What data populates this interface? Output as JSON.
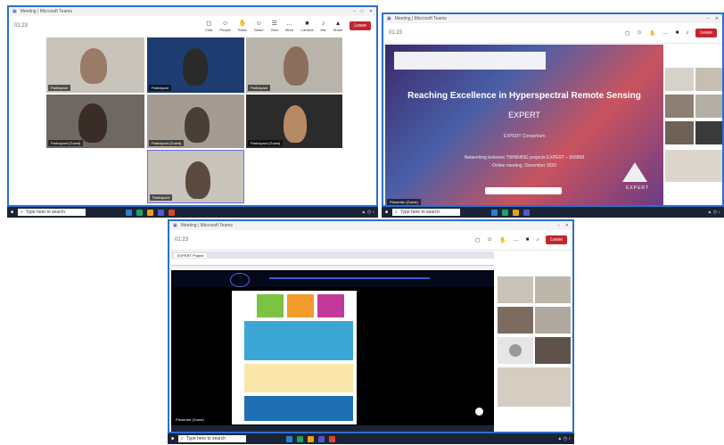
{
  "top_left": {
    "title": "Meeting | Microsoft Teams",
    "timer": "01:23",
    "tools": [
      {
        "icon": "people-icon",
        "label": "Chat"
      },
      {
        "icon": "people-icon",
        "label": "People"
      },
      {
        "icon": "hand-icon",
        "label": "Raise"
      },
      {
        "icon": "react-icon",
        "label": "React"
      },
      {
        "icon": "view-icon",
        "label": "View"
      },
      {
        "icon": "more-icon",
        "label": "More"
      },
      {
        "icon": "camera-icon",
        "label": "Camera"
      },
      {
        "icon": "mic-icon",
        "label": "Mic"
      },
      {
        "icon": "share-icon",
        "label": "Share"
      }
    ],
    "leave": "Leave",
    "participants": [
      "Participant",
      "Participant",
      "Participant",
      "Participant (Guest)",
      "Participant (Guest)",
      "Participant (Guest)",
      "Participant"
    ]
  },
  "top_right": {
    "title": "Meeting | Microsoft Teams",
    "timer": "01:23",
    "leave": "Leave",
    "slide": {
      "title": "Reaching Excellence in Hyperspectral Remote Sensing",
      "acronym": "EXPERT",
      "consortium": "EXPERT Consortium",
      "project": "Networking between TWINNING projects EXPERT – 956808",
      "meeting": "Online meeting, December 2020",
      "brand": "EXPERT"
    },
    "presenter": "Presenter (Guest)"
  },
  "bottom": {
    "title": "Meeting | Microsoft Teams",
    "timer": "01:23",
    "leave": "Leave",
    "browser_tab": "EXPERT Project",
    "presenter": "Presenter (Guest)"
  },
  "taskbar": {
    "search_placeholder": "Type here to search"
  }
}
